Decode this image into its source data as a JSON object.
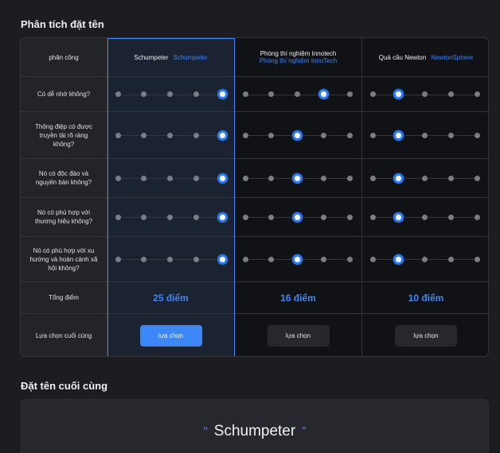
{
  "section_title": "Phân tích đặt tên",
  "final_section_title": "Đặt tên cuối cùng",
  "header_label": "phân công",
  "candidates": [
    {
      "name": "Schumpeter",
      "alt": "Schumpeter",
      "score": "25 điểm",
      "button": "lựa chọn",
      "selected": true
    },
    {
      "name": "Phòng thí nghiệm Innotech",
      "alt": "Phòng thí nghiệm InnoTech",
      "score": "16 điểm",
      "button": "lựa chọn",
      "selected": false
    },
    {
      "name": "Quả cầu Newton",
      "alt": "NewtonSphere",
      "score": "10 điểm",
      "button": "lựa chọn",
      "selected": false
    }
  ],
  "criteria": [
    {
      "label": "Có dễ nhớ không?",
      "ratings": [
        5,
        4,
        2
      ]
    },
    {
      "label": "Thông điệp có được truyền tải rõ ràng không?",
      "ratings": [
        5,
        3,
        2
      ]
    },
    {
      "label": "Nó có độc đáo và nguyên bản không?",
      "ratings": [
        5,
        3,
        2
      ]
    },
    {
      "label": "Nó có phù hợp với thương hiệu không?",
      "ratings": [
        5,
        3,
        2
      ]
    },
    {
      "label": "Nó có phù hợp với xu hướng và hoàn cảnh xã hội không?",
      "ratings": [
        5,
        3,
        2
      ]
    }
  ],
  "total_label": "Tổng điểm",
  "final_choice_label": "Lựa chọn cuối cùng",
  "final_name": "Schumpeter",
  "quote_open": "“",
  "quote_close": "”",
  "rating_scale_max": 5,
  "accent_color": "#3d86f5"
}
